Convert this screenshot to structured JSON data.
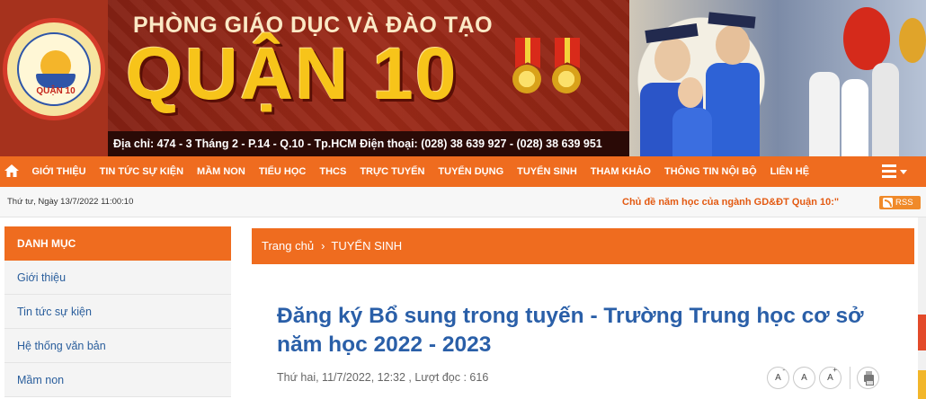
{
  "banner": {
    "org_line": "PHÒNG GIÁO DỤC VÀ ĐÀO TẠO",
    "district": "QUẬN 10",
    "address_line": "Địa chỉ: 474 - 3 Tháng 2 - P.14 - Q.10 - Tp.HCM  Điện thoại: (028) 38 639 927 - (028) 38 639 951",
    "logo_text": "QUẬN 10"
  },
  "nav": {
    "items": [
      "GIỚI THIỆU",
      "TIN TỨC SỰ KIỆN",
      "MẦM NON",
      "TIỂU HỌC",
      "THCS",
      "TRỰC TUYẾN",
      "TUYỂN DỤNG",
      "TUYỂN SINH",
      "THAM KHẢO",
      "THÔNG TIN NỘI BỘ",
      "LIÊN HỆ"
    ],
    "accent": "#ef6c1f",
    "home_icon": "home-icon",
    "menu_icon": "hamburger-menu-icon"
  },
  "info_bar": {
    "date": "Thứ tư, Ngày 13/7/2022 11:00:10",
    "marquee": "Chủ đề năm học của ngành GD&ĐT Quận 10:\"",
    "rss_label": "RSS"
  },
  "sidebar": {
    "title": "DANH MỤC",
    "items": [
      "Giới thiệu",
      "Tin tức sự kiện",
      "Hệ thống văn bản",
      "Mầm non"
    ]
  },
  "breadcrumb": {
    "home": "Trang chủ",
    "separator": "›",
    "current": "TUYỂN SINH"
  },
  "article": {
    "title": "Đăng ký Bổ sung trong tuyến - Trường Trung học cơ sở năm học 2022 - 2023",
    "meta": "Thứ hai, 11/7/2022, 12:32 , Lượt đọc : 616",
    "font_tools": {
      "smaller": "A",
      "smaller_sup": "-",
      "normal": "A",
      "larger": "A",
      "larger_sup": "+"
    },
    "title_color": "#2a5fa8"
  }
}
